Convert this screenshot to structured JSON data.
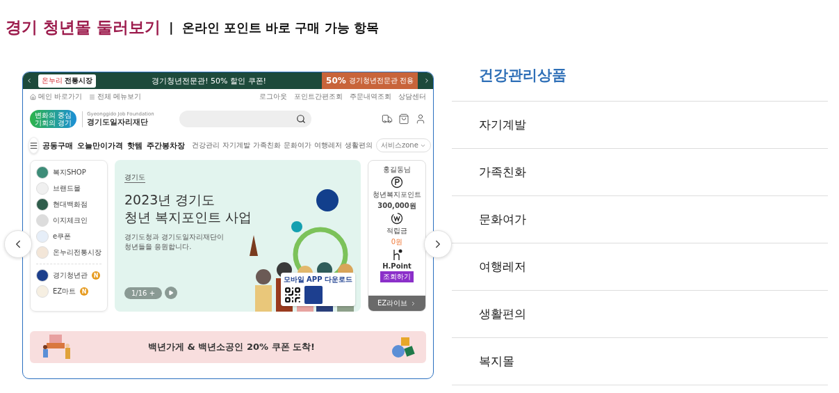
{
  "header": {
    "title": "경기 청년몰 둘러보기",
    "separator": "|",
    "subtitle": "온라인 포인트 바로 구매 가능 항목"
  },
  "preview": {
    "top_banner": {
      "logo_small": "온누리",
      "logo_main": "전통시장",
      "text": "경기청년전문관! 50% 할인 쿠폰!",
      "coupon_value": "50%",
      "coupon_text": "경기청년전문관 전용"
    },
    "utility_left": [
      "메인 바로가기",
      "전체 메뉴보기"
    ],
    "utility_right": [
      "로그아웃",
      "포인트간편조회",
      "주문내역조회",
      "상담센터"
    ],
    "logo": {
      "slogan": [
        "변화의 중심",
        "기회의 경기"
      ],
      "english": "Gyeonggido Job Foundation",
      "name": "경기도일자리재단"
    },
    "main_nav": [
      "공동구매",
      "오늘만이가격",
      "핫템",
      "주간봉차장"
    ],
    "category_nav": [
      "건강관리",
      "자기계발",
      "가족친화",
      "문화여가",
      "여행레저",
      "생활편의"
    ],
    "service_dropdown": "서비스zone",
    "shop_links": [
      {
        "label": "복지SHOP",
        "color": "#3d8c78"
      },
      {
        "label": "브랜드몰",
        "color": "#f0f0f0"
      },
      {
        "label": "현대백화점",
        "color": "#2f5d4b"
      },
      {
        "label": "이지체크인",
        "color": "#dcdcdc"
      },
      {
        "label": "e쿠폰",
        "color": "#e6eef8"
      },
      {
        "label": "온누리전통시장",
        "color": "#f3e6d8"
      }
    ],
    "partner_links": [
      {
        "label": "경기청년관",
        "color": "#1c3f8c",
        "badge": "N"
      },
      {
        "label": "EZ마트",
        "color": "#f6efe2",
        "badge": "N"
      }
    ],
    "hero": {
      "eyebrow": "경기도",
      "title": [
        "2023년 경기도",
        "청년 복지포인트 사업"
      ],
      "description": [
        "경기도청과 경기도일자리재단이",
        "청년들을 응원합니다."
      ],
      "pager": "1/16 +",
      "app_download": "모바일 APP 다운로드"
    },
    "user_card": {
      "greeting": "홍길동님",
      "points_label": "청년복지포인트",
      "points_value": "300,000원",
      "reserve_label": "적립금",
      "reserve_value": "0원",
      "hpoint_label": "H.Point",
      "hpoint_action": "조회하기",
      "footer": "EZ라이브"
    },
    "bottom_banner": "백년가게 & 백년소공인 20% 쿠폰 도착!"
  },
  "categories": [
    {
      "label": "건강관리상품",
      "selected": true
    },
    {
      "label": "자기계발",
      "selected": false
    },
    {
      "label": "가족친화",
      "selected": false
    },
    {
      "label": "문화여가",
      "selected": false
    },
    {
      "label": "여행레저",
      "selected": false
    },
    {
      "label": "생활편의",
      "selected": false
    },
    {
      "label": "복지몰",
      "selected": false
    }
  ]
}
